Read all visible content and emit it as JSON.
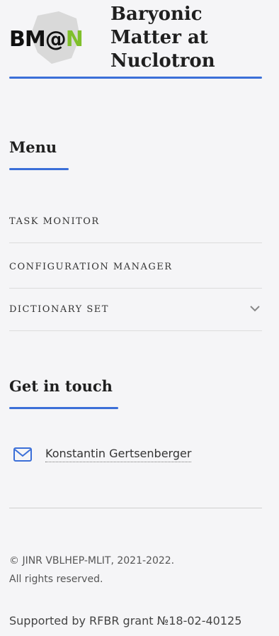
{
  "logo": {
    "text_main": "BM@",
    "text_accent": "N"
  },
  "site_title": {
    "line1": "Baryonic",
    "line2": "Matter at",
    "line3": "Nuclotron"
  },
  "menu": {
    "title": "Menu",
    "items": [
      {
        "label": "TASK MONITOR"
      },
      {
        "label": "CONFIGURATION MANAGER"
      },
      {
        "label": "DICTIONARY SET",
        "icon": "chevron-down-icon"
      }
    ]
  },
  "contact": {
    "title": "Get in touch",
    "name": "Konstantin Gertsenberger",
    "icon": "mail-icon"
  },
  "footer": {
    "copyright": "© JINR VBLHEP-MLIT, 2021-2022.",
    "rights": "All rights reserved.",
    "support": "Supported by RFBR grant №18-02-40125"
  },
  "colors": {
    "accent": "#3b6fd8",
    "logo_green": "#7fbf2a",
    "background": "#f5f5f7"
  }
}
